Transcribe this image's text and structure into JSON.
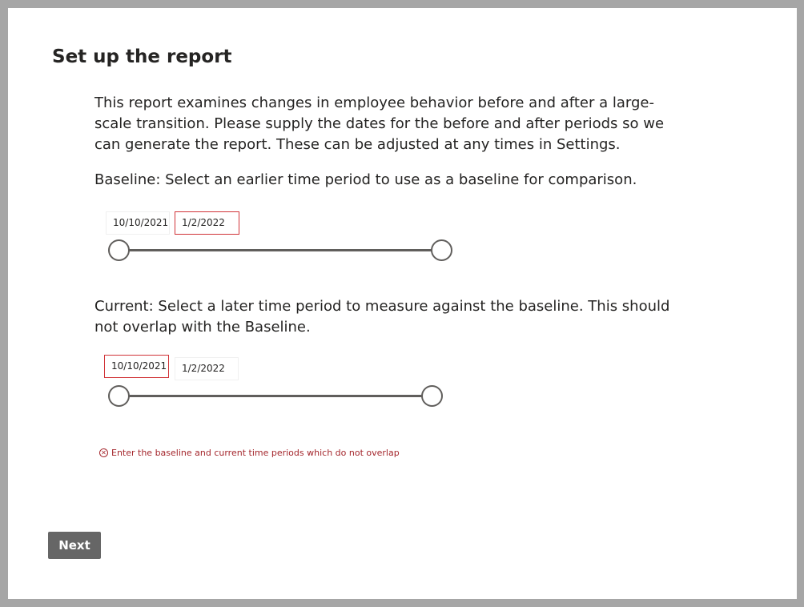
{
  "title": "Set up the report",
  "intro": "This report examines changes in employee behavior before and after a large-scale transition. Please supply the dates for the before and after periods so we can generate the report. These can be adjusted at any times in Settings.",
  "baseline": {
    "description": "Baseline: Select an earlier time period to use as a baseline for comparison.",
    "start_date": "10/10/2021",
    "end_date": "1/2/2022",
    "start_invalid": false,
    "end_invalid": true
  },
  "current": {
    "description": "Current: Select a later time period to measure against the baseline. This should not overlap with the Baseline.",
    "start_date": "10/10/2021",
    "end_date": "1/2/2022",
    "start_invalid": true,
    "end_invalid": false
  },
  "error": {
    "icon": "error-circle-icon",
    "message": "Enter the baseline and current time periods which do not overlap",
    "color": "#a4262c"
  },
  "next_button": "Next"
}
